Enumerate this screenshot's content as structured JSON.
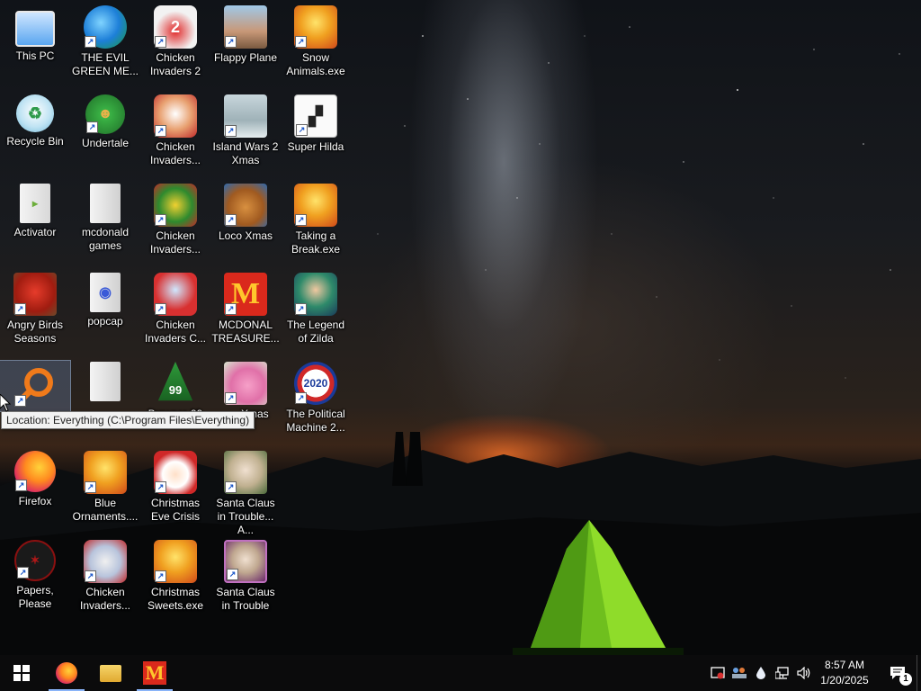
{
  "desktop": {
    "icons": [
      {
        "id": "this-pc",
        "label": "This PC"
      },
      {
        "id": "recycle-bin",
        "label": "Recycle Bin"
      },
      {
        "id": "activator",
        "label": "Activator"
      },
      {
        "id": "angry-birds-seasons",
        "label": "Angry Birds Seasons"
      },
      {
        "id": "everything",
        "label": ""
      },
      {
        "id": "firefox",
        "label": "Firefox"
      },
      {
        "id": "papers-please",
        "label": "Papers, Please"
      },
      {
        "id": "evil-green-me",
        "label": "THE EVIL GREEN ME..."
      },
      {
        "id": "undertale",
        "label": "Undertale"
      },
      {
        "id": "mcdonald-games",
        "label": "mcdonald games"
      },
      {
        "id": "popcap",
        "label": "popcap"
      },
      {
        "id": "folder-blank",
        "label": ""
      },
      {
        "id": "blue-ornaments",
        "label": "Blue Ornaments...."
      },
      {
        "id": "chicken-invaders-col2",
        "label": "Chicken Invaders..."
      },
      {
        "id": "chicken-invaders-2",
        "label": "Chicken Invaders 2"
      },
      {
        "id": "chicken-invaders-b",
        "label": "Chicken Invaders..."
      },
      {
        "id": "chicken-invaders-c",
        "label": "Chicken Invaders..."
      },
      {
        "id": "chicken-invaders-cx",
        "label": "Chicken Invaders C..."
      },
      {
        "id": "browser-99",
        "label": "Browser 99"
      },
      {
        "id": "christmas-eve-crisis",
        "label": "Christmas Eve Crisis"
      },
      {
        "id": "christmas-sweets",
        "label": "Christmas Sweets.exe"
      },
      {
        "id": "flappy-plane",
        "label": "Flappy Plane"
      },
      {
        "id": "island-wars-2-xmas",
        "label": "Island Wars 2 Xmas"
      },
      {
        "id": "loco-xmas",
        "label": "Loco Xmas"
      },
      {
        "id": "mcdonal-treasure",
        "label": "MCDONAL TREASURE..."
      },
      {
        "id": "xmas-pig",
        "label": "Xmas"
      },
      {
        "id": "santa-claus-trouble-a",
        "label": "Santa Claus in Trouble... A..."
      },
      {
        "id": "santa-claus-trouble",
        "label": "Santa Claus in Trouble"
      },
      {
        "id": "snow-animals",
        "label": "Snow Animals.exe"
      },
      {
        "id": "super-hilda",
        "label": "Super Hilda"
      },
      {
        "id": "taking-a-break",
        "label": "Taking a Break.exe"
      },
      {
        "id": "legend-of-zilda",
        "label": "The Legend of Zilda"
      },
      {
        "id": "political-machine",
        "label": "The Political Machine 2..."
      }
    ],
    "tooltip": "Location: Everything (C:\\Program Files\\Everything)"
  },
  "taskbar": {
    "clock_time": "8:57 AM",
    "clock_date": "1/20/2025",
    "notification_count": "1"
  },
  "colors": {
    "taskbar_bg": "#0b0b0c",
    "accent": "#8ab4f8",
    "tent": "#7ed321",
    "horizon_glow": "#e8702a"
  }
}
